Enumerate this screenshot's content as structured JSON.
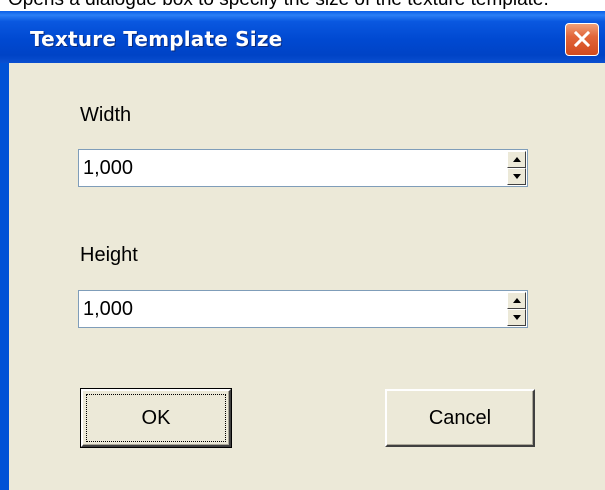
{
  "caption": "Opens a dialogue box to specify the size of the texture template.",
  "dialog": {
    "title": "Texture Template Size",
    "close_icon": "close-icon",
    "width_label": "Width",
    "width_value": "1,000",
    "height_label": "Height",
    "height_value": "1,000",
    "ok_label": "OK",
    "cancel_label": "Cancel"
  },
  "colors": {
    "titlebar": "#0049d1",
    "client": "#ece9d8",
    "close_button": "#e2663a"
  }
}
